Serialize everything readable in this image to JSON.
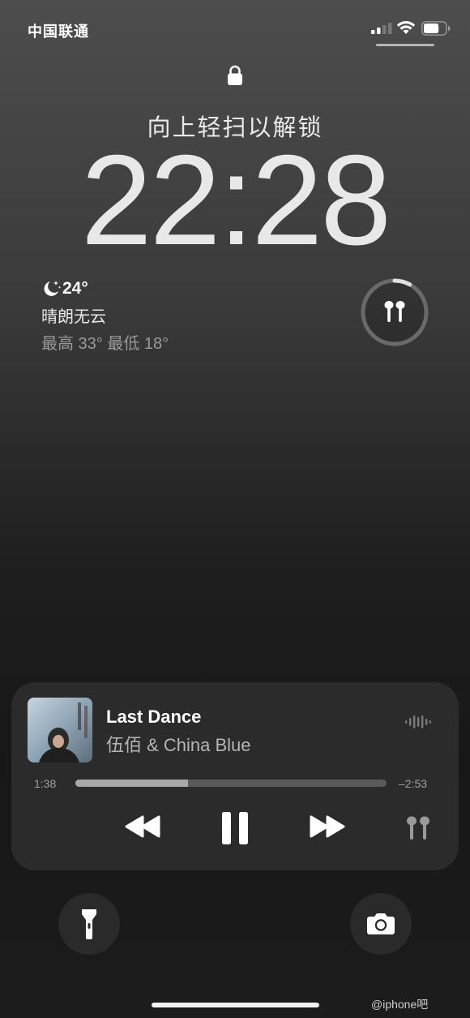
{
  "status_bar": {
    "carrier": "中国联通",
    "signal_bars": 2,
    "battery_level": 0.7
  },
  "lock_screen": {
    "swipe_hint": "向上轻扫以解锁",
    "time": "22:28"
  },
  "weather": {
    "icon": "moon-stars-icon",
    "temperature": "24°",
    "condition": "晴朗无云",
    "range": "最高 33° 最低 18°"
  },
  "airpods_widget": {
    "icon": "airpods-icon",
    "battery_level": 0.08
  },
  "now_playing": {
    "title": "Last Dance",
    "artist": "伍佰 & China Blue",
    "elapsed": "1:38",
    "remaining": "–2:53",
    "progress": 0.362
  },
  "quick_actions": {
    "left": "flashlight-icon",
    "right": "camera-icon"
  },
  "watermark": "@iphone吧"
}
